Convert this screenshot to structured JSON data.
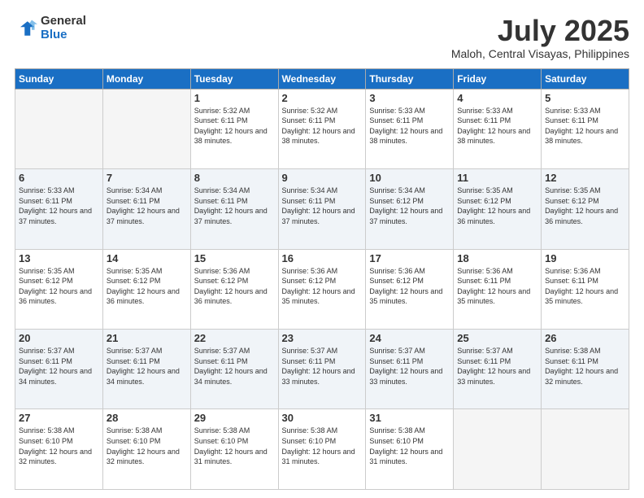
{
  "header": {
    "logo_general": "General",
    "logo_blue": "Blue",
    "title": "July 2025",
    "subtitle": "Maloh, Central Visayas, Philippines"
  },
  "calendar": {
    "days_of_week": [
      "Sunday",
      "Monday",
      "Tuesday",
      "Wednesday",
      "Thursday",
      "Friday",
      "Saturday"
    ],
    "weeks": [
      [
        {
          "day": "",
          "empty": true
        },
        {
          "day": "",
          "empty": true
        },
        {
          "day": "1",
          "sunrise": "Sunrise: 5:32 AM",
          "sunset": "Sunset: 6:11 PM",
          "daylight": "Daylight: 12 hours and 38 minutes."
        },
        {
          "day": "2",
          "sunrise": "Sunrise: 5:32 AM",
          "sunset": "Sunset: 6:11 PM",
          "daylight": "Daylight: 12 hours and 38 minutes."
        },
        {
          "day": "3",
          "sunrise": "Sunrise: 5:33 AM",
          "sunset": "Sunset: 6:11 PM",
          "daylight": "Daylight: 12 hours and 38 minutes."
        },
        {
          "day": "4",
          "sunrise": "Sunrise: 5:33 AM",
          "sunset": "Sunset: 6:11 PM",
          "daylight": "Daylight: 12 hours and 38 minutes."
        },
        {
          "day": "5",
          "sunrise": "Sunrise: 5:33 AM",
          "sunset": "Sunset: 6:11 PM",
          "daylight": "Daylight: 12 hours and 38 minutes."
        }
      ],
      [
        {
          "day": "6",
          "sunrise": "Sunrise: 5:33 AM",
          "sunset": "Sunset: 6:11 PM",
          "daylight": "Daylight: 12 hours and 37 minutes."
        },
        {
          "day": "7",
          "sunrise": "Sunrise: 5:34 AM",
          "sunset": "Sunset: 6:11 PM",
          "daylight": "Daylight: 12 hours and 37 minutes."
        },
        {
          "day": "8",
          "sunrise": "Sunrise: 5:34 AM",
          "sunset": "Sunset: 6:11 PM",
          "daylight": "Daylight: 12 hours and 37 minutes."
        },
        {
          "day": "9",
          "sunrise": "Sunrise: 5:34 AM",
          "sunset": "Sunset: 6:11 PM",
          "daylight": "Daylight: 12 hours and 37 minutes."
        },
        {
          "day": "10",
          "sunrise": "Sunrise: 5:34 AM",
          "sunset": "Sunset: 6:12 PM",
          "daylight": "Daylight: 12 hours and 37 minutes."
        },
        {
          "day": "11",
          "sunrise": "Sunrise: 5:35 AM",
          "sunset": "Sunset: 6:12 PM",
          "daylight": "Daylight: 12 hours and 36 minutes."
        },
        {
          "day": "12",
          "sunrise": "Sunrise: 5:35 AM",
          "sunset": "Sunset: 6:12 PM",
          "daylight": "Daylight: 12 hours and 36 minutes."
        }
      ],
      [
        {
          "day": "13",
          "sunrise": "Sunrise: 5:35 AM",
          "sunset": "Sunset: 6:12 PM",
          "daylight": "Daylight: 12 hours and 36 minutes."
        },
        {
          "day": "14",
          "sunrise": "Sunrise: 5:35 AM",
          "sunset": "Sunset: 6:12 PM",
          "daylight": "Daylight: 12 hours and 36 minutes."
        },
        {
          "day": "15",
          "sunrise": "Sunrise: 5:36 AM",
          "sunset": "Sunset: 6:12 PM",
          "daylight": "Daylight: 12 hours and 36 minutes."
        },
        {
          "day": "16",
          "sunrise": "Sunrise: 5:36 AM",
          "sunset": "Sunset: 6:12 PM",
          "daylight": "Daylight: 12 hours and 35 minutes."
        },
        {
          "day": "17",
          "sunrise": "Sunrise: 5:36 AM",
          "sunset": "Sunset: 6:12 PM",
          "daylight": "Daylight: 12 hours and 35 minutes."
        },
        {
          "day": "18",
          "sunrise": "Sunrise: 5:36 AM",
          "sunset": "Sunset: 6:11 PM",
          "daylight": "Daylight: 12 hours and 35 minutes."
        },
        {
          "day": "19",
          "sunrise": "Sunrise: 5:36 AM",
          "sunset": "Sunset: 6:11 PM",
          "daylight": "Daylight: 12 hours and 35 minutes."
        }
      ],
      [
        {
          "day": "20",
          "sunrise": "Sunrise: 5:37 AM",
          "sunset": "Sunset: 6:11 PM",
          "daylight": "Daylight: 12 hours and 34 minutes."
        },
        {
          "day": "21",
          "sunrise": "Sunrise: 5:37 AM",
          "sunset": "Sunset: 6:11 PM",
          "daylight": "Daylight: 12 hours and 34 minutes."
        },
        {
          "day": "22",
          "sunrise": "Sunrise: 5:37 AM",
          "sunset": "Sunset: 6:11 PM",
          "daylight": "Daylight: 12 hours and 34 minutes."
        },
        {
          "day": "23",
          "sunrise": "Sunrise: 5:37 AM",
          "sunset": "Sunset: 6:11 PM",
          "daylight": "Daylight: 12 hours and 33 minutes."
        },
        {
          "day": "24",
          "sunrise": "Sunrise: 5:37 AM",
          "sunset": "Sunset: 6:11 PM",
          "daylight": "Daylight: 12 hours and 33 minutes."
        },
        {
          "day": "25",
          "sunrise": "Sunrise: 5:37 AM",
          "sunset": "Sunset: 6:11 PM",
          "daylight": "Daylight: 12 hours and 33 minutes."
        },
        {
          "day": "26",
          "sunrise": "Sunrise: 5:38 AM",
          "sunset": "Sunset: 6:11 PM",
          "daylight": "Daylight: 12 hours and 32 minutes."
        }
      ],
      [
        {
          "day": "27",
          "sunrise": "Sunrise: 5:38 AM",
          "sunset": "Sunset: 6:10 PM",
          "daylight": "Daylight: 12 hours and 32 minutes."
        },
        {
          "day": "28",
          "sunrise": "Sunrise: 5:38 AM",
          "sunset": "Sunset: 6:10 PM",
          "daylight": "Daylight: 12 hours and 32 minutes."
        },
        {
          "day": "29",
          "sunrise": "Sunrise: 5:38 AM",
          "sunset": "Sunset: 6:10 PM",
          "daylight": "Daylight: 12 hours and 31 minutes."
        },
        {
          "day": "30",
          "sunrise": "Sunrise: 5:38 AM",
          "sunset": "Sunset: 6:10 PM",
          "daylight": "Daylight: 12 hours and 31 minutes."
        },
        {
          "day": "31",
          "sunrise": "Sunrise: 5:38 AM",
          "sunset": "Sunset: 6:10 PM",
          "daylight": "Daylight: 12 hours and 31 minutes."
        },
        {
          "day": "",
          "empty": true
        },
        {
          "day": "",
          "empty": true
        }
      ]
    ]
  }
}
